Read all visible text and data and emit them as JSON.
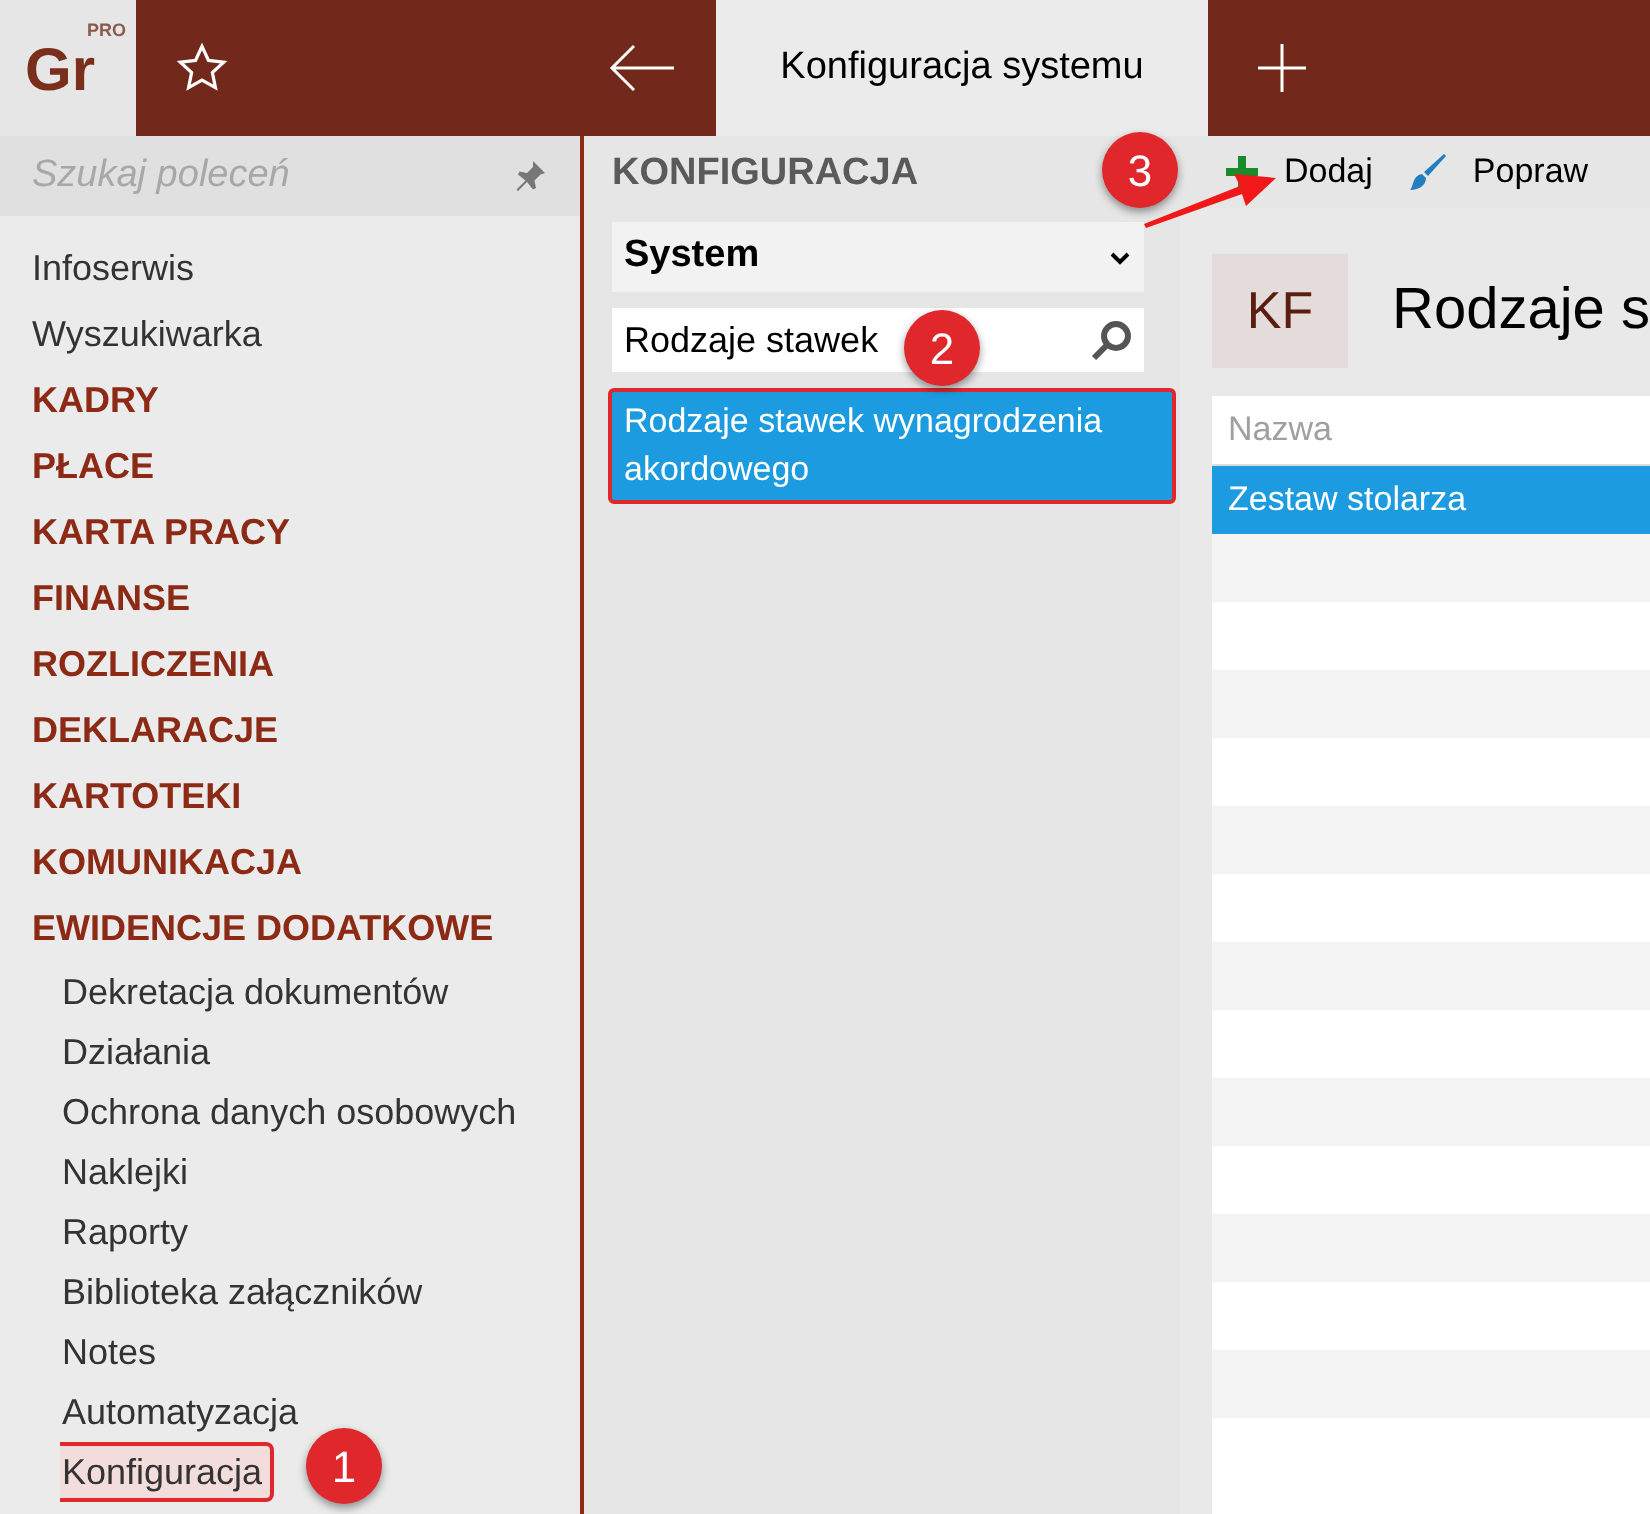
{
  "header": {
    "logo": "Gr",
    "logo_badge": "PRO",
    "tabs": [
      {
        "label": "Konfiguracja systemu",
        "selected": true
      }
    ]
  },
  "sidebar": {
    "search": {
      "placeholder": "Szukaj poleceń"
    },
    "items": [
      {
        "label": "Infoserwis",
        "kind": "link",
        "selected": false
      },
      {
        "label": "Wyszukiwarka",
        "kind": "link",
        "selected": false
      },
      {
        "label": "KADRY",
        "kind": "section",
        "selected": false
      },
      {
        "label": "PŁACE",
        "kind": "section",
        "selected": false
      },
      {
        "label": "KARTA PRACY",
        "kind": "section",
        "selected": false
      },
      {
        "label": "FINANSE",
        "kind": "section",
        "selected": false
      },
      {
        "label": "ROZLICZENIA",
        "kind": "section",
        "selected": false
      },
      {
        "label": "DEKLARACJE",
        "kind": "section",
        "selected": false
      },
      {
        "label": "KARTOTEKI",
        "kind": "section",
        "selected": false
      },
      {
        "label": "KOMUNIKACJA",
        "kind": "section",
        "selected": false
      },
      {
        "label": "EWIDENCJE DODATKOWE",
        "kind": "section",
        "selected": false,
        "children": [
          {
            "label": "Dekretacja dokumentów",
            "selected": false
          },
          {
            "label": "Działania",
            "selected": false
          },
          {
            "label": "Ochrona danych osobowych",
            "selected": false
          },
          {
            "label": "Naklejki",
            "selected": false
          },
          {
            "label": "Raporty",
            "selected": false
          },
          {
            "label": "Biblioteka załączników",
            "selected": false
          },
          {
            "label": "Notes",
            "selected": false
          },
          {
            "label": "Automatyzacja",
            "selected": false
          },
          {
            "label": "Konfiguracja",
            "selected": true
          }
        ]
      }
    ]
  },
  "config_panel": {
    "title": "KONFIGURACJA",
    "dropdown": {
      "value": "System"
    },
    "search": {
      "value": "Rodzaje stawek"
    },
    "results": [
      {
        "label": "Rodzaje stawek wynagrodzenia akordowego",
        "selected": true
      }
    ]
  },
  "toolbar": {
    "buttons": [
      {
        "label": "Dodaj",
        "kind": "add"
      },
      {
        "label": "Popraw",
        "kind": "edit"
      }
    ]
  },
  "content": {
    "badge": "KF",
    "title": "Rodzaje s",
    "table": {
      "columns": [
        "Nazwa"
      ],
      "rows": [
        {
          "cells": [
            "Zestaw stolarza"
          ],
          "selected": true
        }
      ]
    }
  },
  "annotations": [
    {
      "label": "1"
    },
    {
      "label": "2"
    },
    {
      "label": "3"
    }
  ]
}
